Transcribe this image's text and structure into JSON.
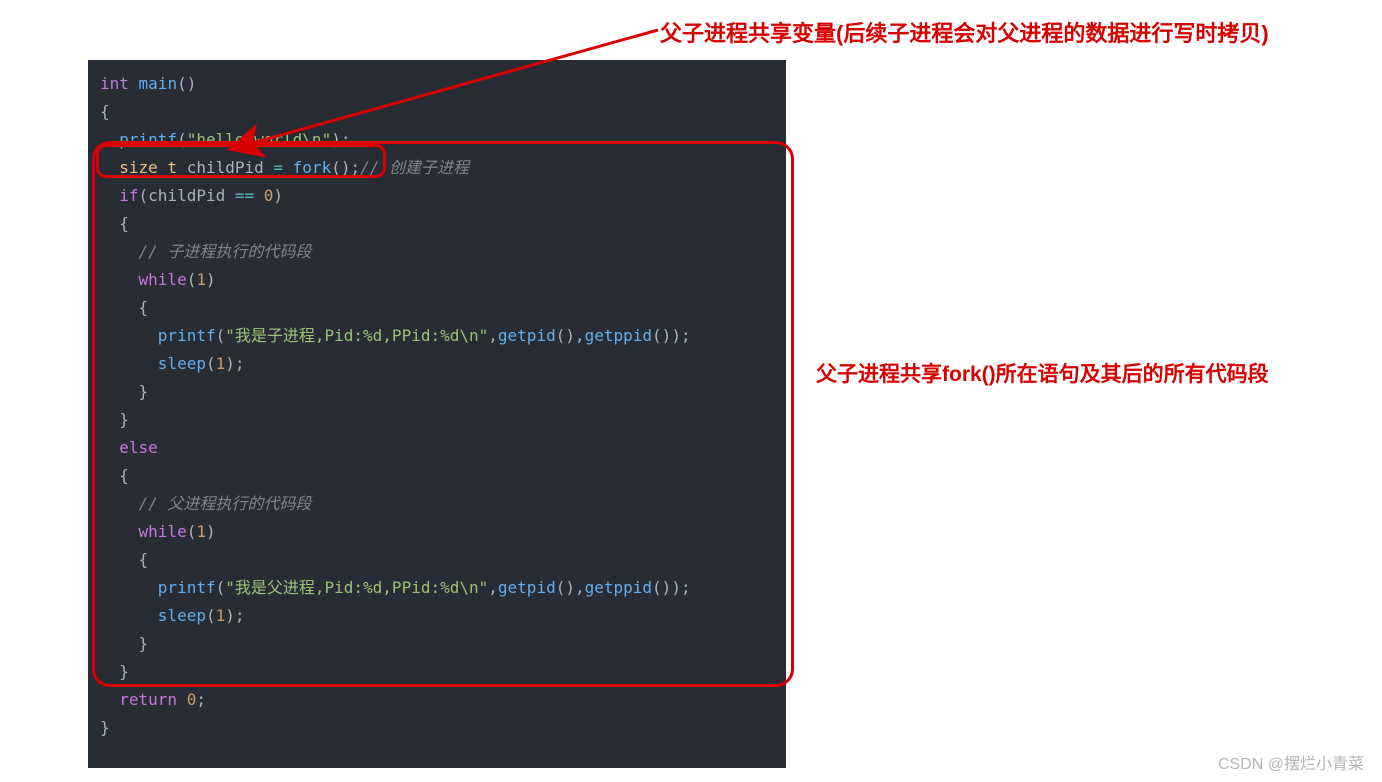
{
  "annotations": {
    "top": "父子进程共享变量(后续子进程会对父进程的数据进行写时拷贝)",
    "side": "父子进程共享fork()所在语句及其后的所有代码段"
  },
  "code": {
    "l1_kw": "int",
    "l1_fn": " main",
    "l1_rest": "()",
    "l2": "{",
    "l3_pad": "  ",
    "l3_fn": "printf",
    "l3_p1": "(",
    "l3_str": "\"hello world\\n\"",
    "l3_p2": ");",
    "l4_pad": "  ",
    "l4_type": "size_t",
    "l4_var": " childPid ",
    "l4_eq": "=",
    "l4_fn": " fork",
    "l4_p": "();",
    "l4_cmt": "// 创建子进程",
    "l5_pad": "  ",
    "l5_kw": "if",
    "l5_p": "(childPid ",
    "l5_op": "==",
    "l5_n": " 0",
    "l5_e": ")",
    "l6": "  {",
    "l7_pad": "    ",
    "l7_cmt": "// 子进程执行的代码段",
    "l8_pad": "    ",
    "l8_kw": "while",
    "l8_p": "(",
    "l8_n": "1",
    "l8_e": ")",
    "l9": "    {",
    "l10_pad": "      ",
    "l10_fn": "printf",
    "l10_p1": "(",
    "l10_str": "\"我是子进程,Pid:%d,PPid:%d\\n\"",
    "l10_c": ",",
    "l10_fn2": "getpid",
    "l10_p2": "(),",
    "l10_fn3": "getppid",
    "l10_p3": "());",
    "l11_pad": "      ",
    "l11_fn": "sleep",
    "l11_p1": "(",
    "l11_n": "1",
    "l11_p2": ");",
    "l12": "    }",
    "l13": "  }",
    "l14_pad": "  ",
    "l14_kw": "else",
    "l15": "  {",
    "l16_pad": "    ",
    "l16_cmt": "// 父进程执行的代码段",
    "l17_pad": "    ",
    "l17_kw": "while",
    "l17_p": "(",
    "l17_n": "1",
    "l17_e": ")",
    "l18": "    {",
    "l19_pad": "      ",
    "l19_fn": "printf",
    "l19_p1": "(",
    "l19_str": "\"我是父进程,Pid:%d,PPid:%d\\n\"",
    "l19_c": ",",
    "l19_fn2": "getpid",
    "l19_p2": "(),",
    "l19_fn3": "getppid",
    "l19_p3": "());",
    "l20_pad": "      ",
    "l20_fn": "sleep",
    "l20_p1": "(",
    "l20_n": "1",
    "l20_p2": ");",
    "l21": "    }",
    "l22": "  }",
    "l23": "",
    "l24_pad": "  ",
    "l24_kw": "return",
    "l24_n": " 0",
    "l24_e": ";",
    "l25": "}"
  },
  "watermark": "CSDN @摆烂小青菜"
}
